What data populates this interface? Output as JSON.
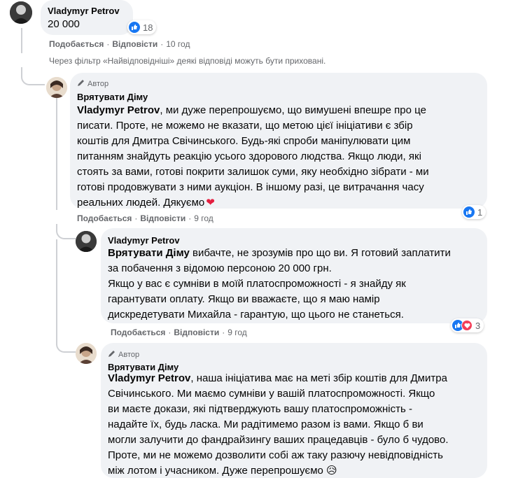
{
  "top_comment": {
    "author": "Vladymyr Petrov",
    "text": "20 000",
    "reaction_count": "18",
    "like_label": "Подобається",
    "reply_label": "Відповісти",
    "time": "10 год"
  },
  "filter_notice": "Через фільтр «Найвідповідніші» деякі відповіді можуть бути приховані.",
  "reply1": {
    "author_tag": "Автор",
    "author": "Врятувати Діму",
    "mention": "Vladymyr Petrov",
    "lines": [
      ", ми дуже перепрошуємо, що вимушені впешре про це",
      "писати. Проте, не можемо не вказати, що метою цієї ініціативи є збір",
      "коштів для Дмитра Свічинського. Будь-які спроби маніпулювати цим",
      "питанням знайдуть реакцію усього здорового людства. Якщо люди, які",
      "стоять за вами, готові покрити залишок суми, яку необхідно зібрати - ми",
      "готові продовжувати з ними аукціон. В іншому разі, це витрачання часу",
      "реальних людей. Дякуємо"
    ],
    "heart": "❤",
    "reaction_count": "1",
    "like_label": "Подобається",
    "reply_label": "Відповісти",
    "time": "9 год"
  },
  "reply2": {
    "author": "Vladymyr Petrov",
    "mention": "Врятувати Діму",
    "lines": [
      " вибачте, не зрозумів про що ви. Я готовий заплатити",
      "за побачення з відомою персоною 20 000 грн.",
      "Якщо у вас є сумніви в моїй платоспроможності - я знайду як",
      "гарантувати оплату. Якщо ви вважаєте, що я маю намір",
      "дискредетувати Михайла - гарантую, що цього не станеться."
    ],
    "reaction_count": "3",
    "like_label": "Подобається",
    "reply_label": "Відповісти",
    "time": "9 год"
  },
  "reply3": {
    "author_tag": "Автор",
    "author": "Врятувати Діму",
    "mention": "Vladymyr Petrov",
    "lines": [
      ", наша ініціатива має на меті збір коштів для Дмитра",
      "Свічинського. Ми маємо сумніви у вашій платоспроможності. Якщо",
      "ви маєте докази, які підтверджують вашу платоспроможність -",
      "надайте їх, будь ласка. Ми радітимемо разом із вами. Якщо б ви",
      "могли залучити до фандрайзингу ваших працедавців - було б чудово.",
      "Проте, ми не можемо дозволити собі аж таку разючу невідповідність",
      "між лотом і учасником. Дуже перепрошуємо"
    ],
    "emoji": "😥"
  },
  "colors": {
    "bubble": "#f0f2f5",
    "meta": "#65676b",
    "like_blue": "#1877f2",
    "love_red": "#f33e58"
  }
}
